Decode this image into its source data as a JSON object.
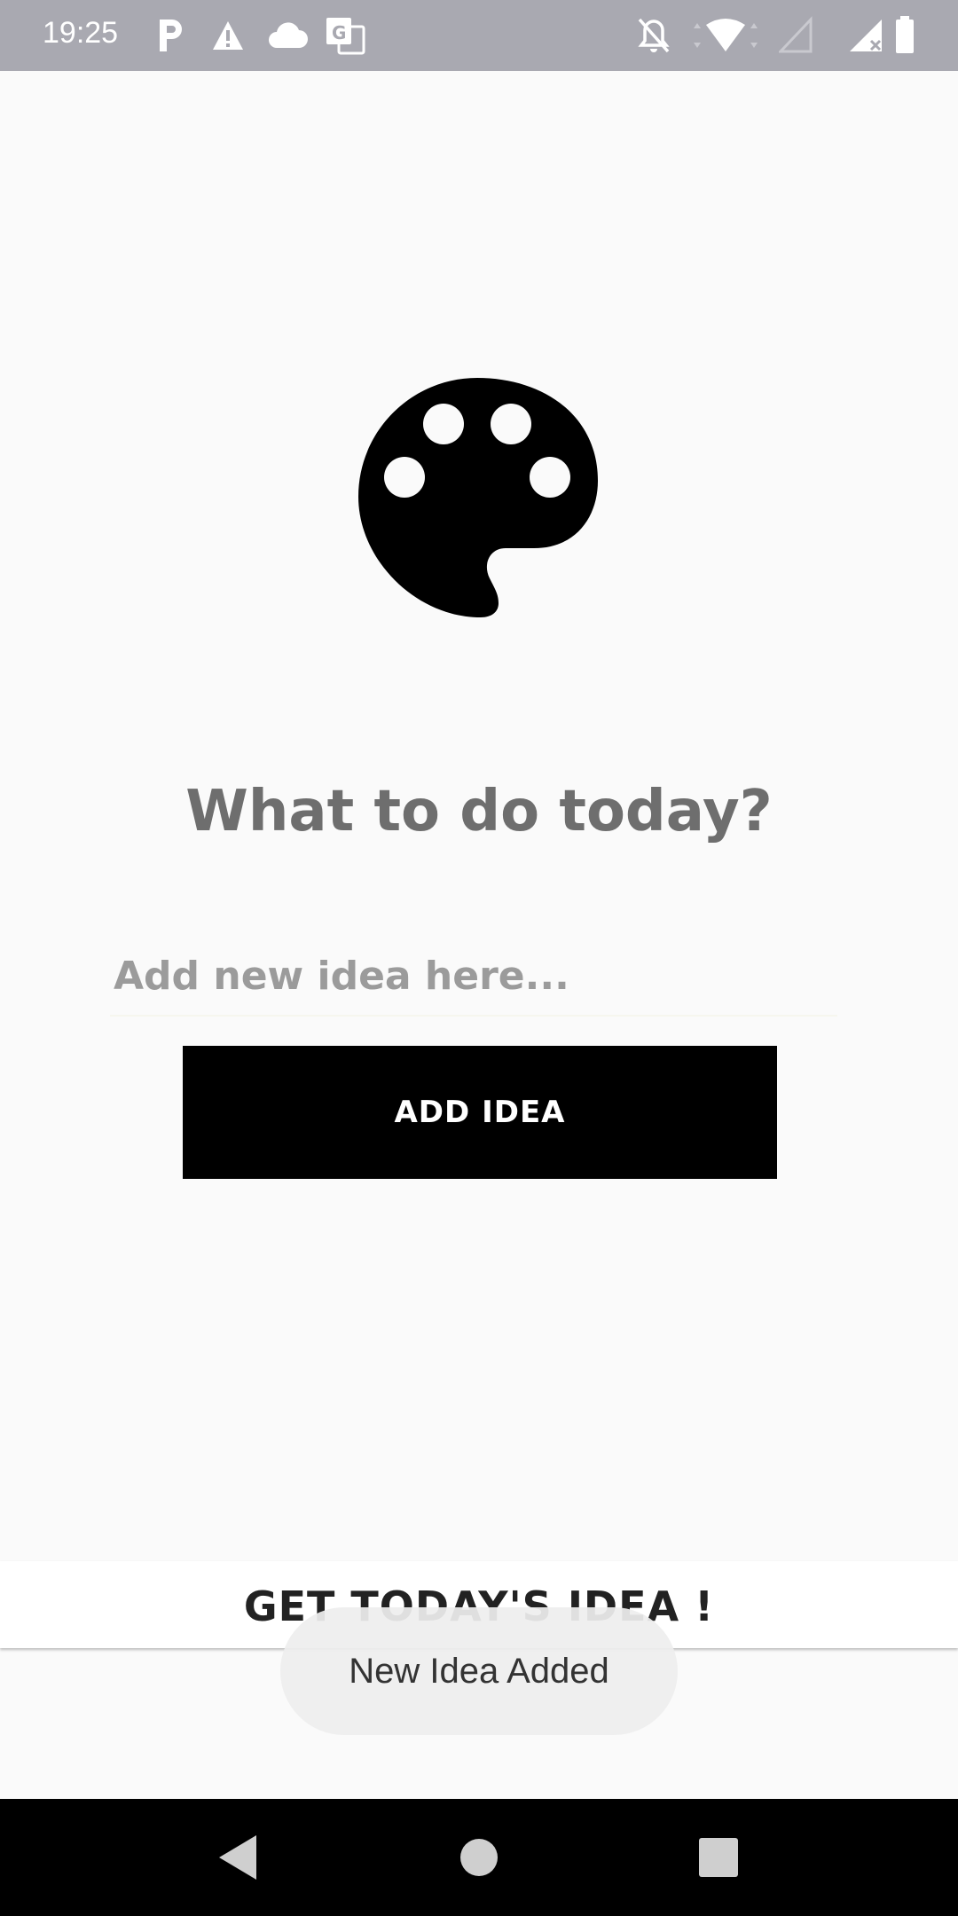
{
  "status_bar": {
    "time": "19:25",
    "icons": [
      "parking-icon",
      "warning-icon",
      "cloud-icon",
      "translate-icon",
      "notifications-off-icon",
      "wifi-icon",
      "signal-empty-icon",
      "signal-no-sim-icon",
      "battery-icon"
    ],
    "background": "#a9a9b1"
  },
  "main": {
    "icon": "palette-icon",
    "headline": "What to do today?",
    "input": {
      "placeholder": "Add new idea here...",
      "value": ""
    },
    "add_button_label": "ADD IDEA"
  },
  "bottom_bar": {
    "label": "GET TODAY'S IDEA !"
  },
  "toast": {
    "message": "New Idea Added"
  },
  "nav_bar": {
    "icons": [
      "back-icon",
      "home-icon",
      "recents-icon"
    ]
  }
}
